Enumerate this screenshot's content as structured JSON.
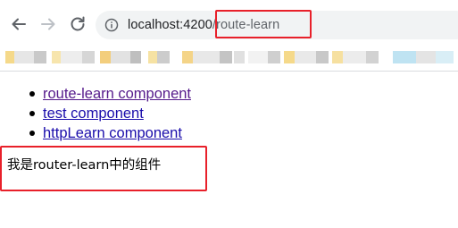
{
  "browser": {
    "url_host": "localhost:4200",
    "url_path": "/route-learn"
  },
  "icons": {
    "back": "arrow-left-icon",
    "forward": "arrow-right-icon",
    "reload": "reload-icon",
    "info": "info-icon"
  },
  "colors": {
    "highlight": "#e8202a",
    "visited_link": "#551a8b",
    "link": "#1a0dab"
  },
  "page": {
    "nav_links": [
      {
        "label": "route-learn component"
      },
      {
        "label": "test component"
      },
      {
        "label": "httpLearn component"
      }
    ],
    "content_text": "我是router-learn中的组件"
  }
}
